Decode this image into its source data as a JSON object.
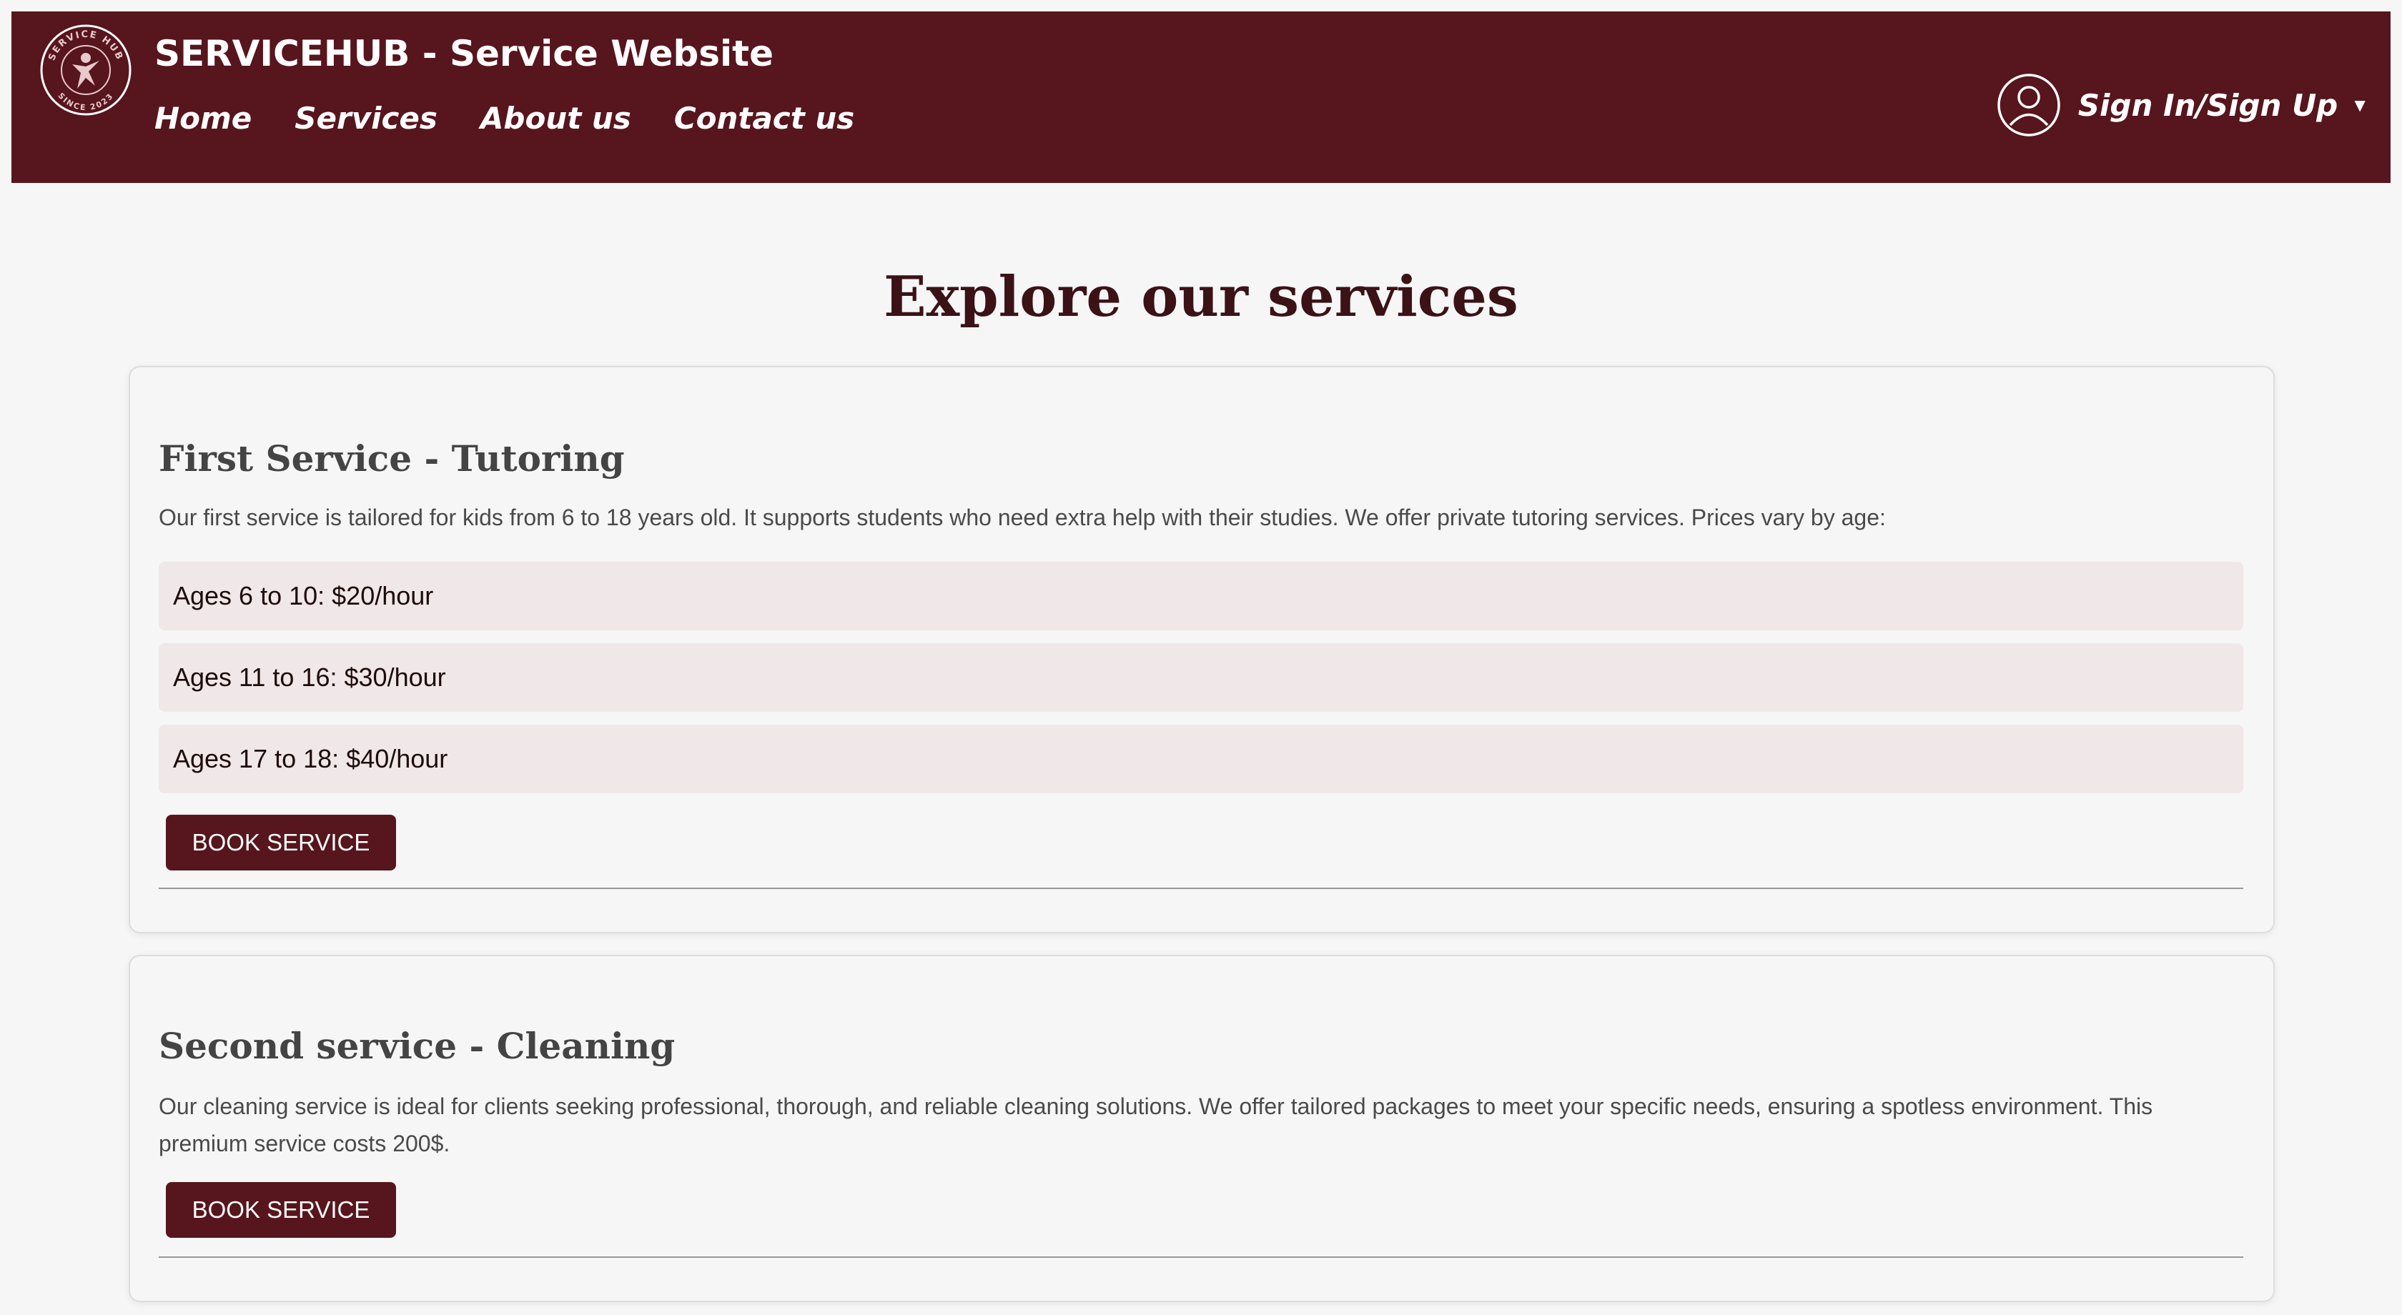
{
  "header": {
    "logo": {
      "icon": "service-hub-logo",
      "ring_text_top": "SERVICE HUB",
      "ring_text_bottom": "SINCE 2023"
    },
    "title": "SERVICEHUB - Service Website",
    "nav": [
      {
        "label": "Home"
      },
      {
        "label": "Services"
      },
      {
        "label": "About us"
      },
      {
        "label": "Contact us"
      }
    ],
    "account": {
      "icon": "user-circle-icon",
      "label": "Sign In/Sign Up",
      "caret_icon": "caret-down-icon"
    },
    "background_color": "#57151d",
    "text_color": "#ffffff"
  },
  "main": {
    "heading": "Explore our services",
    "services": [
      {
        "title": "First Service - Tutoring",
        "description": "Our first service is tailored for kids from 6 to 18 years old. It supports students who need extra help with their studies. We offer private tutoring services. Prices vary by age:",
        "prices": [
          "Ages 6 to 10: $20/hour",
          "Ages 11 to 16: $30/hour",
          "Ages 17 to 18: $40/hour"
        ],
        "button_label": "BOOK SERVICE"
      },
      {
        "title": "Second service - Cleaning",
        "description": "Our cleaning service is ideal for clients seeking professional, thorough, and reliable cleaning solutions. We offer tailored packages to meet your specific needs, ensuring a spotless environment. This premium service costs 200$.",
        "button_label": "BOOK SERVICE"
      }
    ]
  },
  "colors": {
    "brand": "#57151d",
    "page_background": "#f6f6f6",
    "price_item_background": "#f0e8e8",
    "heading_text": "#3b1216"
  }
}
